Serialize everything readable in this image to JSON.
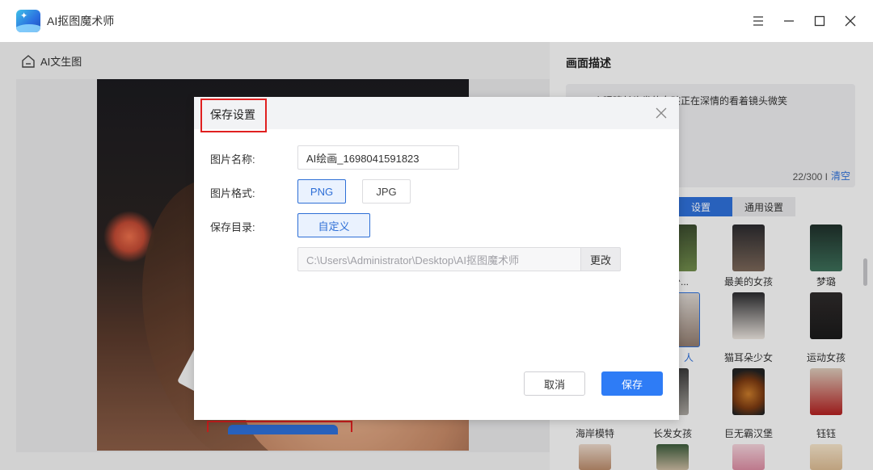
{
  "app": {
    "title": "AI抠图魔术师",
    "logo_icon": "app-logo-icon"
  },
  "window_controls": [
    "menu-icon",
    "minimize-icon",
    "maximize-icon",
    "close-icon"
  ],
  "left_panel": {
    "back_link_label": "AI文生图"
  },
  "right_panel": {
    "description_title": "画面描述",
    "description_text": "一个眼睛长头发的女孩正在深情的看着镜头微笑",
    "char_count": "22/300 I",
    "clear_label": "清空",
    "tabs": [
      {
        "label": "设置",
        "active": true
      },
      {
        "label": "通用设置",
        "active": false
      }
    ],
    "thumbnails": [
      {
        "label": "的少..."
      },
      {
        "label": "最美的女孩"
      },
      {
        "label": "梦璐"
      },
      {
        "label": "人"
      },
      {
        "label": "猫耳朵少女"
      },
      {
        "label": "运动女孩"
      },
      {
        "label": "海岸模特"
      },
      {
        "label": "长发女孩"
      },
      {
        "label": "巨无霸汉堡"
      },
      {
        "label": "钰钰"
      }
    ]
  },
  "dialog": {
    "title": "保存设置",
    "name_label": "图片名称:",
    "name_value": "AI绘画_1698041591823",
    "format_label": "图片格式:",
    "format_options": [
      "PNG",
      "JPG"
    ],
    "format_selected": "PNG",
    "dir_label": "保存目录:",
    "custom_label": "自定义",
    "path_placeholder": "C:\\Users\\Administrator\\Desktop\\AI抠图魔术师",
    "change_label": "更改",
    "cancel_label": "取消",
    "save_label": "保存"
  },
  "colors": {
    "accent": "#2e7cf6",
    "highlight_red": "#e02020"
  }
}
